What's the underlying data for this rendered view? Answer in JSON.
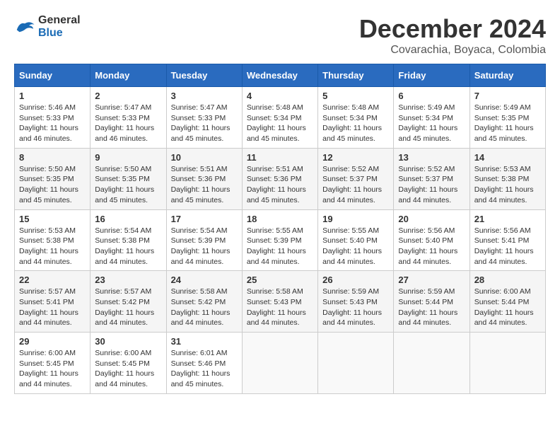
{
  "logo": {
    "line1": "General",
    "line2": "Blue"
  },
  "title": "December 2024",
  "subtitle": "Covarachia, Boyaca, Colombia",
  "headers": [
    "Sunday",
    "Monday",
    "Tuesday",
    "Wednesday",
    "Thursday",
    "Friday",
    "Saturday"
  ],
  "weeks": [
    [
      {
        "day": "1",
        "info": "Sunrise: 5:46 AM\nSunset: 5:33 PM\nDaylight: 11 hours and 46 minutes."
      },
      {
        "day": "2",
        "info": "Sunrise: 5:47 AM\nSunset: 5:33 PM\nDaylight: 11 hours and 46 minutes."
      },
      {
        "day": "3",
        "info": "Sunrise: 5:47 AM\nSunset: 5:33 PM\nDaylight: 11 hours and 45 minutes."
      },
      {
        "day": "4",
        "info": "Sunrise: 5:48 AM\nSunset: 5:34 PM\nDaylight: 11 hours and 45 minutes."
      },
      {
        "day": "5",
        "info": "Sunrise: 5:48 AM\nSunset: 5:34 PM\nDaylight: 11 hours and 45 minutes."
      },
      {
        "day": "6",
        "info": "Sunrise: 5:49 AM\nSunset: 5:34 PM\nDaylight: 11 hours and 45 minutes."
      },
      {
        "day": "7",
        "info": "Sunrise: 5:49 AM\nSunset: 5:35 PM\nDaylight: 11 hours and 45 minutes."
      }
    ],
    [
      {
        "day": "8",
        "info": "Sunrise: 5:50 AM\nSunset: 5:35 PM\nDaylight: 11 hours and 45 minutes."
      },
      {
        "day": "9",
        "info": "Sunrise: 5:50 AM\nSunset: 5:35 PM\nDaylight: 11 hours and 45 minutes."
      },
      {
        "day": "10",
        "info": "Sunrise: 5:51 AM\nSunset: 5:36 PM\nDaylight: 11 hours and 45 minutes."
      },
      {
        "day": "11",
        "info": "Sunrise: 5:51 AM\nSunset: 5:36 PM\nDaylight: 11 hours and 45 minutes."
      },
      {
        "day": "12",
        "info": "Sunrise: 5:52 AM\nSunset: 5:37 PM\nDaylight: 11 hours and 44 minutes."
      },
      {
        "day": "13",
        "info": "Sunrise: 5:52 AM\nSunset: 5:37 PM\nDaylight: 11 hours and 44 minutes."
      },
      {
        "day": "14",
        "info": "Sunrise: 5:53 AM\nSunset: 5:38 PM\nDaylight: 11 hours and 44 minutes."
      }
    ],
    [
      {
        "day": "15",
        "info": "Sunrise: 5:53 AM\nSunset: 5:38 PM\nDaylight: 11 hours and 44 minutes."
      },
      {
        "day": "16",
        "info": "Sunrise: 5:54 AM\nSunset: 5:38 PM\nDaylight: 11 hours and 44 minutes."
      },
      {
        "day": "17",
        "info": "Sunrise: 5:54 AM\nSunset: 5:39 PM\nDaylight: 11 hours and 44 minutes."
      },
      {
        "day": "18",
        "info": "Sunrise: 5:55 AM\nSunset: 5:39 PM\nDaylight: 11 hours and 44 minutes."
      },
      {
        "day": "19",
        "info": "Sunrise: 5:55 AM\nSunset: 5:40 PM\nDaylight: 11 hours and 44 minutes."
      },
      {
        "day": "20",
        "info": "Sunrise: 5:56 AM\nSunset: 5:40 PM\nDaylight: 11 hours and 44 minutes."
      },
      {
        "day": "21",
        "info": "Sunrise: 5:56 AM\nSunset: 5:41 PM\nDaylight: 11 hours and 44 minutes."
      }
    ],
    [
      {
        "day": "22",
        "info": "Sunrise: 5:57 AM\nSunset: 5:41 PM\nDaylight: 11 hours and 44 minutes."
      },
      {
        "day": "23",
        "info": "Sunrise: 5:57 AM\nSunset: 5:42 PM\nDaylight: 11 hours and 44 minutes."
      },
      {
        "day": "24",
        "info": "Sunrise: 5:58 AM\nSunset: 5:42 PM\nDaylight: 11 hours and 44 minutes."
      },
      {
        "day": "25",
        "info": "Sunrise: 5:58 AM\nSunset: 5:43 PM\nDaylight: 11 hours and 44 minutes."
      },
      {
        "day": "26",
        "info": "Sunrise: 5:59 AM\nSunset: 5:43 PM\nDaylight: 11 hours and 44 minutes."
      },
      {
        "day": "27",
        "info": "Sunrise: 5:59 AM\nSunset: 5:44 PM\nDaylight: 11 hours and 44 minutes."
      },
      {
        "day": "28",
        "info": "Sunrise: 6:00 AM\nSunset: 5:44 PM\nDaylight: 11 hours and 44 minutes."
      }
    ],
    [
      {
        "day": "29",
        "info": "Sunrise: 6:00 AM\nSunset: 5:45 PM\nDaylight: 11 hours and 44 minutes."
      },
      {
        "day": "30",
        "info": "Sunrise: 6:00 AM\nSunset: 5:45 PM\nDaylight: 11 hours and 44 minutes."
      },
      {
        "day": "31",
        "info": "Sunrise: 6:01 AM\nSunset: 5:46 PM\nDaylight: 11 hours and 45 minutes."
      },
      {
        "day": "",
        "info": ""
      },
      {
        "day": "",
        "info": ""
      },
      {
        "day": "",
        "info": ""
      },
      {
        "day": "",
        "info": ""
      }
    ]
  ]
}
